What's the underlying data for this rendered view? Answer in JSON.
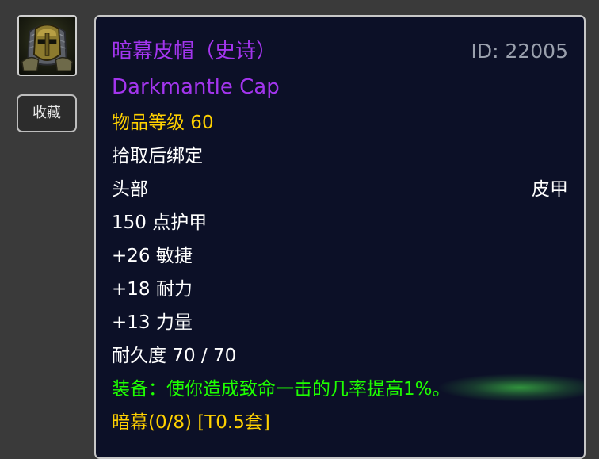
{
  "item": {
    "icon": "helmet-icon",
    "favorite_label": "收藏",
    "name_cn": "暗幕皮帽（史诗）",
    "name_en": "Darkmantle Cap",
    "id_label": "ID: 22005",
    "item_level": "物品等级 60",
    "binding": "拾取后绑定",
    "slot": "头部",
    "armor_type": "皮甲",
    "armor": "150 点护甲",
    "stats": [
      "+26 敏捷",
      "+18 耐力",
      "+13 力量"
    ],
    "durability": "耐久度 70 / 70",
    "equip_effect": "装备：使你造成致命一击的几率提高1%。",
    "set_name": "暗幕(0/8) [T0.5套]"
  },
  "colors": {
    "epic": "#a335ee",
    "item_level": "#ffd100",
    "equip_effect": "#1eff00",
    "set_name": "#ffd100",
    "tooltip_bg": "#0c1027",
    "page_bg": "#3a3a3a"
  }
}
